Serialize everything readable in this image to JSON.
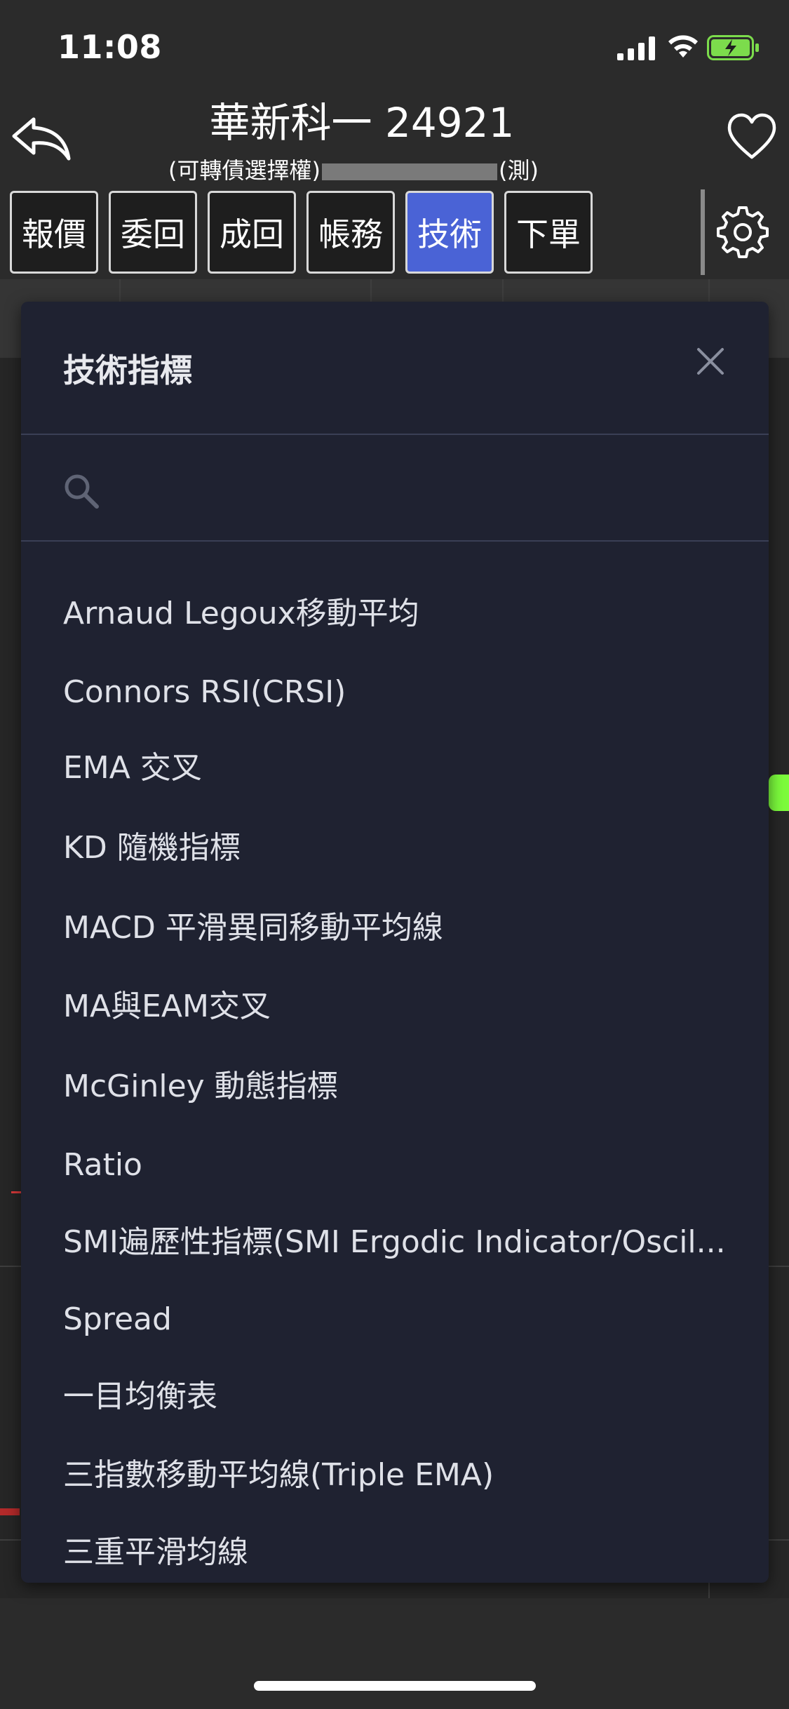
{
  "status_bar": {
    "time": "11:08"
  },
  "header": {
    "title": "華新科一 24921",
    "subtitle_prefix": "(可轉債選擇權)",
    "subtitle_suffix": "(測)"
  },
  "tabs": [
    {
      "label": "報價"
    },
    {
      "label": "委回"
    },
    {
      "label": "成回"
    },
    {
      "label": "帳務"
    },
    {
      "label": "技術",
      "active": true
    },
    {
      "label": "下單"
    }
  ],
  "modal": {
    "title": "技術指標",
    "search": {
      "value": "",
      "placeholder": ""
    },
    "items": [
      "Arnaud Legoux移動平均",
      "Connors RSI(CRSI)",
      "EMA 交叉",
      "KD 隨機指標",
      "MACD 平滑異同移動平均線",
      "MA與EAM交叉",
      "McGinley 動態指標",
      "Ratio",
      "SMI遍歷性指標(SMI Ergodic Indicator/Oscil...",
      "Spread",
      "一目均衡表",
      "三指數移動平均線(Triple EMA)",
      "三重平滑均線"
    ]
  },
  "colors": {
    "active_tab": "#4a63d6",
    "modal_bg": "#1f2231",
    "accent_green": "#7cfc3c"
  }
}
